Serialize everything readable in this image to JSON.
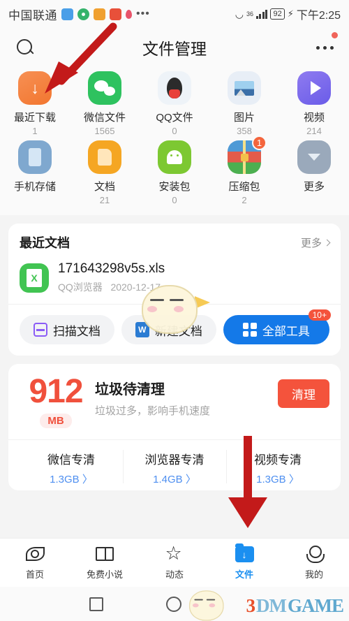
{
  "statusbar": {
    "carrier": "中国联通",
    "network": "36",
    "battery": "92",
    "time": "下午2:25",
    "icons": [
      "telegram-icon",
      "browser-icon",
      "media-icon",
      "app-icon",
      "location-pin-icon",
      "overflow-dots-icon"
    ]
  },
  "header": {
    "title": "文件管理",
    "search_icon": "search-icon",
    "more_icon": "more-options-icon"
  },
  "grid": {
    "items": [
      {
        "label": "最近下载",
        "count": "1",
        "icon": "download-icon"
      },
      {
        "label": "微信文件",
        "count": "1565",
        "icon": "wechat-icon"
      },
      {
        "label": "QQ文件",
        "count": "0",
        "icon": "qq-icon"
      },
      {
        "label": "图片",
        "count": "358",
        "icon": "picture-icon"
      },
      {
        "label": "视频",
        "count": "214",
        "icon": "video-icon"
      },
      {
        "label": "手机存储",
        "count": "",
        "icon": "phone-storage-icon"
      },
      {
        "label": "文档",
        "count": "21",
        "icon": "document-icon"
      },
      {
        "label": "安装包",
        "count": "0",
        "icon": "apk-icon"
      },
      {
        "label": "压缩包",
        "count": "2",
        "icon": "archive-icon",
        "badge": "1"
      },
      {
        "label": "更多",
        "count": "",
        "icon": "more-down-icon"
      }
    ]
  },
  "recent_docs": {
    "title": "最近文档",
    "more_label": "更多",
    "file": {
      "name": "171643298v5s.xls",
      "source": "QQ浏览器",
      "date": "2020-12-17",
      "icon": "xls-file-icon"
    },
    "buttons": [
      {
        "label": "扫描文档",
        "icon": "scan-icon",
        "primary": false,
        "badge": ""
      },
      {
        "label": "新建文档",
        "icon": "word-icon",
        "primary": false,
        "badge": ""
      },
      {
        "label": "全部工具",
        "icon": "grid-icon",
        "primary": true,
        "badge": "10+"
      }
    ]
  },
  "cleanup": {
    "amount": "912",
    "unit": "MB",
    "title": "垃圾待清理",
    "subtitle": "垃圾过多，影响手机速度",
    "action_label": "清理",
    "columns": [
      {
        "label": "微信专清",
        "value": "1.3GB 〉"
      },
      {
        "label": "浏览器专清",
        "value": "1.4GB 〉"
      },
      {
        "label": "视频专清",
        "value": "1.3GB 〉"
      }
    ]
  },
  "tabbar": {
    "items": [
      {
        "label": "首页",
        "icon": "home-eye-icon",
        "active": false
      },
      {
        "label": "免费小说",
        "icon": "book-icon",
        "active": false
      },
      {
        "label": "动态",
        "icon": "star-icon",
        "active": false
      },
      {
        "label": "文件",
        "icon": "folder-icon",
        "active": true
      },
      {
        "label": "我的",
        "icon": "person-icon",
        "active": false
      }
    ]
  },
  "navbar": {
    "recent": "square-nav-icon",
    "home": "circle-nav-icon"
  },
  "watermark": {
    "text_1": "3",
    "text_2": "DM",
    "text_3": "GAME",
    "mascot": "bird-mascot-icon"
  },
  "annotations": {
    "arrow_1": "red-arrow-pointing-to-recent-downloads",
    "arrow_2": "red-arrow-pointing-to-files-tab"
  },
  "colors": {
    "accent_blue": "#1479e8",
    "danger_red": "#f4533c",
    "arrow_red": "#c31a1a"
  }
}
